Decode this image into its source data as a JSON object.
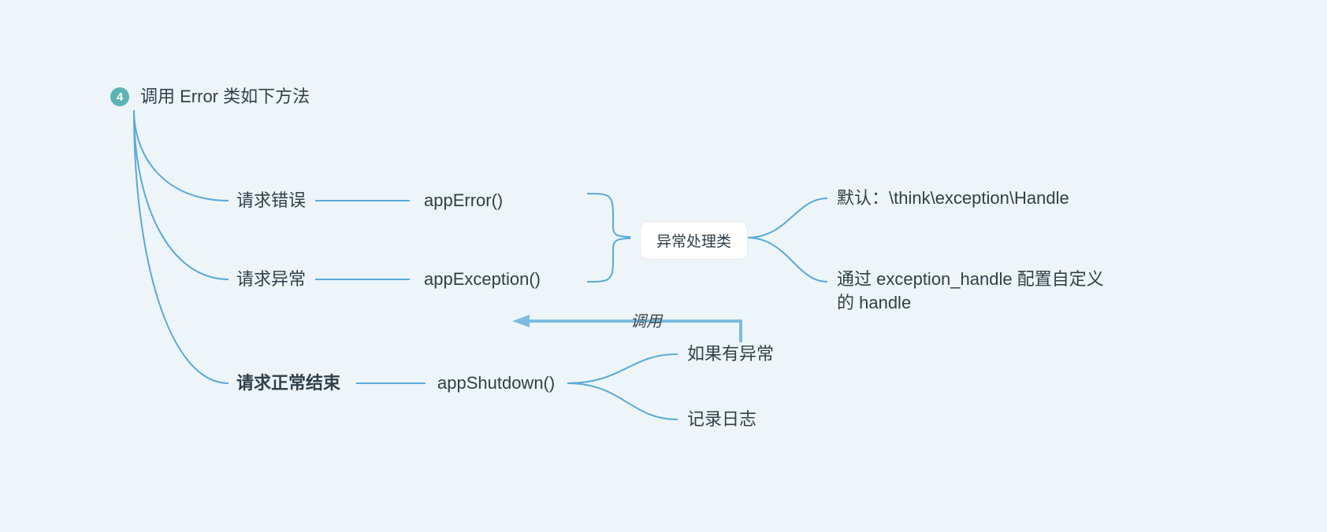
{
  "root": {
    "badge": "4",
    "title": "调用 Error 类如下方法"
  },
  "branches": {
    "b1": {
      "label": "请求错误",
      "method": "appError()"
    },
    "b2": {
      "label": "请求异常",
      "method": "appException()"
    },
    "b3": {
      "label": "请求正常结束",
      "method": "appShutdown()"
    }
  },
  "exceptionClass": {
    "box": "异常处理类",
    "opt1": "默认：\\think\\exception\\Handle",
    "opt2": "通过 exception_handle 配置自定义的 handle"
  },
  "shutdownChildren": {
    "c1": "如果有异常",
    "c2": "记录日志"
  },
  "relation": {
    "label": "调用"
  }
}
